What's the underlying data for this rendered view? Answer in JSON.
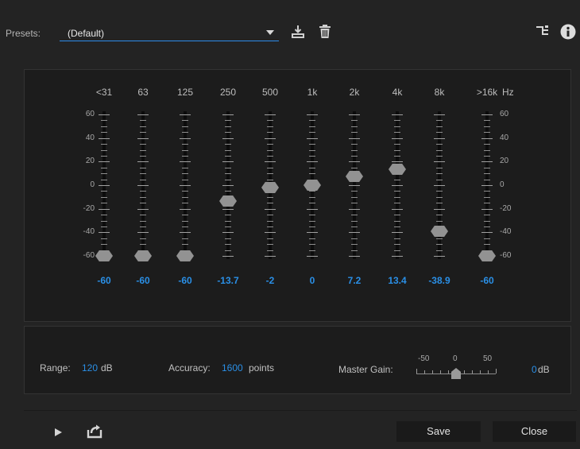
{
  "presets": {
    "label": "Presets:",
    "value": "(Default)"
  },
  "icons": {
    "save_preset": "save-preset-icon",
    "delete_preset": "trash-icon",
    "routing": "channel-routing-icon",
    "info": "info-icon",
    "play": "play-icon",
    "export": "export-icon"
  },
  "eq": {
    "bands": [
      "<31",
      "63",
      "125",
      "250",
      "500",
      "1k",
      "2k",
      "4k",
      "8k",
      ">16k"
    ],
    "unit": "Hz",
    "values": [
      "-60",
      "-60",
      "-60",
      "-13.7",
      "-2",
      "0",
      "7.2",
      "13.4",
      "-38.9",
      "-60"
    ],
    "gain_values": [
      -60,
      -60,
      -60,
      -13.7,
      -2,
      0,
      7.2,
      13.4,
      -38.9,
      -60
    ],
    "scale": [
      "60",
      "40",
      "20",
      "0",
      "-20",
      "-40",
      "-60"
    ],
    "range_max": 60,
    "range_min": -60
  },
  "settings": {
    "range_label": "Range:",
    "range_value": "120",
    "range_unit": "dB",
    "accuracy_label": "Accuracy:",
    "accuracy_value": "1600",
    "accuracy_unit": "points",
    "master_gain_label": "Master Gain:",
    "master_gain_scale": [
      "-50",
      "0",
      "50"
    ],
    "master_gain_value": "0",
    "master_gain_unit": "dB",
    "master_gain_level": 0
  },
  "buttons": {
    "save": "Save",
    "close": "Close"
  },
  "colors": {
    "accent": "#2a8fe6",
    "background": "#232323",
    "panel": "#1c1c1c"
  }
}
